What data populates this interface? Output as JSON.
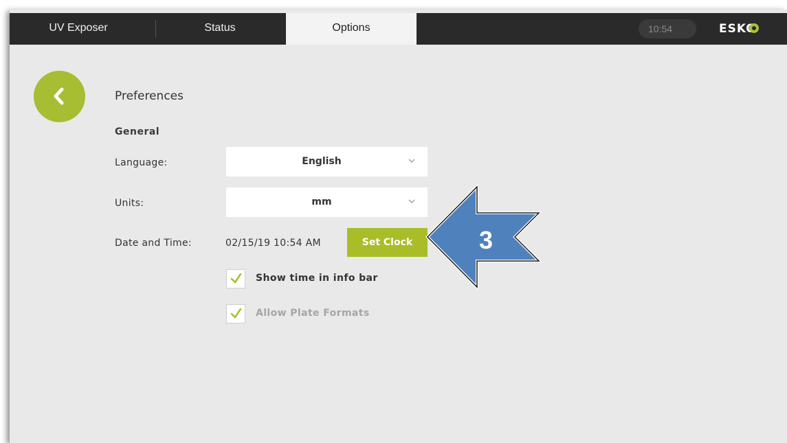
{
  "tabs": {
    "uv_exposer": "UV Exposer",
    "status": "Status",
    "options": "Options"
  },
  "header": {
    "clock": "10:54",
    "logo_text": "ESKO"
  },
  "page": {
    "title": "Preferences",
    "section": "General"
  },
  "fields": {
    "language_label": "Language:",
    "language_value": "English",
    "units_label": "Units:",
    "units_value": "mm",
    "datetime_label": "Date and Time:",
    "datetime_value": "02/15/19 10:54 AM",
    "set_clock_label": "Set Clock"
  },
  "checkboxes": {
    "show_time_label": "Show time in info bar",
    "show_time_checked": true,
    "allow_plate_label": "Allow Plate Formats",
    "allow_plate_checked": true,
    "allow_plate_enabled": false
  },
  "annotation": {
    "step_number": "3"
  },
  "colors": {
    "accent": "#a9bd28",
    "topbar": "#2a2a2a",
    "background": "#e9e9e9",
    "callout_arrow": "#4f81bd"
  },
  "icons": {
    "back": "chevron-left-icon",
    "dropdown": "chevron-down-icon",
    "check": "checkmark-icon"
  }
}
